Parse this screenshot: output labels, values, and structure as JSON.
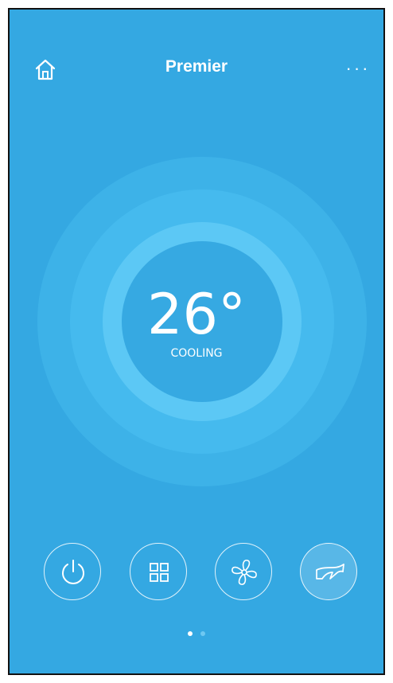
{
  "header": {
    "title": "Premier",
    "home_icon": "home-icon",
    "more_label": "···"
  },
  "thermostat": {
    "temperature": "26°",
    "mode": "COOLING"
  },
  "controls": [
    {
      "name": "power-button",
      "icon": "power-icon"
    },
    {
      "name": "mode-button",
      "icon": "grid-icon"
    },
    {
      "name": "fan-speed-button",
      "icon": "fan-icon"
    },
    {
      "name": "swing-button",
      "icon": "swing-icon"
    }
  ],
  "pagination": {
    "pages": 2,
    "active": 1
  },
  "colors": {
    "background": "#34a8e2",
    "ring_outer": "#3db2e8",
    "ring_middle": "#45baee",
    "ring_inner": "#5cc8f5",
    "dial": "#36a9e2",
    "foreground": "#ffffff"
  }
}
